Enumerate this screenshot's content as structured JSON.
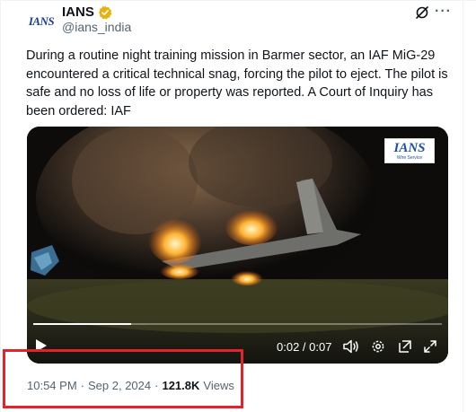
{
  "post": {
    "author_name": "IANS",
    "author_handle": "@ians_india",
    "avatar_text": "IANS",
    "text": "During a routine night training mission in Barmer sector, an IAF MiG-29 encountered a critical technical snag, forcing the pilot to eject. The pilot is safe and no loss of life or property was reported. A Court of Inquiry has been ordered: IAF"
  },
  "media": {
    "watermark": "IANS",
    "watermark_sub": "Wire Service",
    "time_readout": "0:02 / 0:07",
    "progress": 0.24
  },
  "meta": {
    "time": "10:54 PM",
    "separator": "·",
    "date": "Sep 2, 2024",
    "separator2": "·",
    "views_count": "121.8K",
    "views_label": "Views"
  },
  "colors": {
    "verified": "#e8b10e",
    "highlight": "#e3232a",
    "secondary_text": "#536471"
  },
  "icons": [
    "verified-icon",
    "grok-icon",
    "more-icon",
    "play-icon",
    "volume-icon",
    "settings-icon",
    "popout-icon",
    "fullscreen-icon"
  ]
}
